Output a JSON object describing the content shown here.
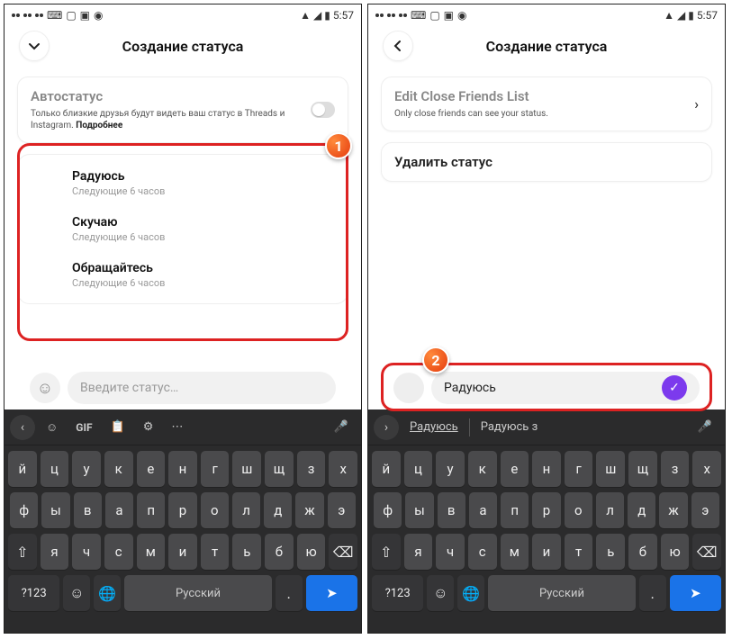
{
  "status": {
    "time": "5:57"
  },
  "left": {
    "title": "Создание статуса",
    "auto": {
      "title": "Автостатус",
      "sub": "Только близкие друзья будут видеть ваш статус в Threads и Instagram.",
      "more": "Подробнее"
    },
    "options": [
      {
        "t": "Радуюсь",
        "s": "Следующие 6 часов"
      },
      {
        "t": "Скучаю",
        "s": "Следующие 6 часов"
      },
      {
        "t": "Обращайтесь",
        "s": "Следующие 6 часов"
      }
    ],
    "placeholder": "Введите статус…",
    "badge": "1"
  },
  "right": {
    "title": "Создание статуса",
    "friends": {
      "t": "Edit Close Friends List",
      "s": "Only close friends can see your status."
    },
    "delete": "Удалить статус",
    "input_value": "Радуюсь",
    "badge": "2",
    "suggestions": [
      "Радуюсь",
      "Радуюсь з"
    ]
  },
  "kb": {
    "toolbar_gif": "GIF",
    "r1": [
      "й",
      "ц",
      "у",
      "к",
      "е",
      "н",
      "г",
      "ш",
      "щ",
      "з",
      "х"
    ],
    "r2": [
      "ф",
      "ы",
      "в",
      "а",
      "п",
      "р",
      "о",
      "л",
      "д",
      "ж",
      "э"
    ],
    "r3": [
      "я",
      "ч",
      "с",
      "м",
      "и",
      "т",
      "ь",
      "б",
      "ю"
    ],
    "numkey": "?123",
    "lang": "Русский"
  }
}
